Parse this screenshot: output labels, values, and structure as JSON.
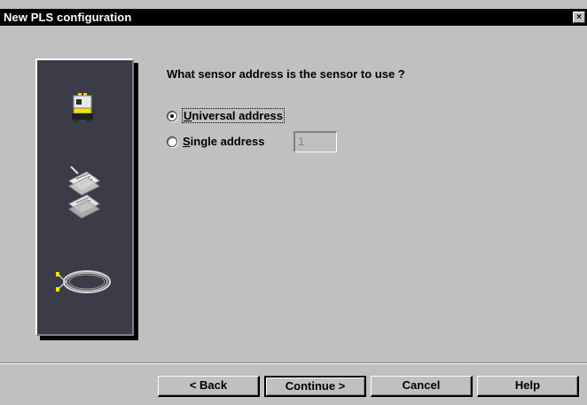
{
  "window": {
    "title": "New PLS configuration",
    "close_glyph": "×"
  },
  "sidepanel": {
    "icons": [
      "sensor-device-icon",
      "document-stack-icon",
      "cable-coil-icon"
    ]
  },
  "form": {
    "question": "What sensor address is the sensor to use ?",
    "options": [
      {
        "label": "Universal address",
        "accel": "U",
        "checked": true
      },
      {
        "label": "Single address",
        "accel": "S",
        "checked": false
      }
    ],
    "address_value": "1"
  },
  "buttons": {
    "back": "< Back",
    "continue": "Continue >",
    "cancel": "Cancel",
    "help": "Help"
  }
}
